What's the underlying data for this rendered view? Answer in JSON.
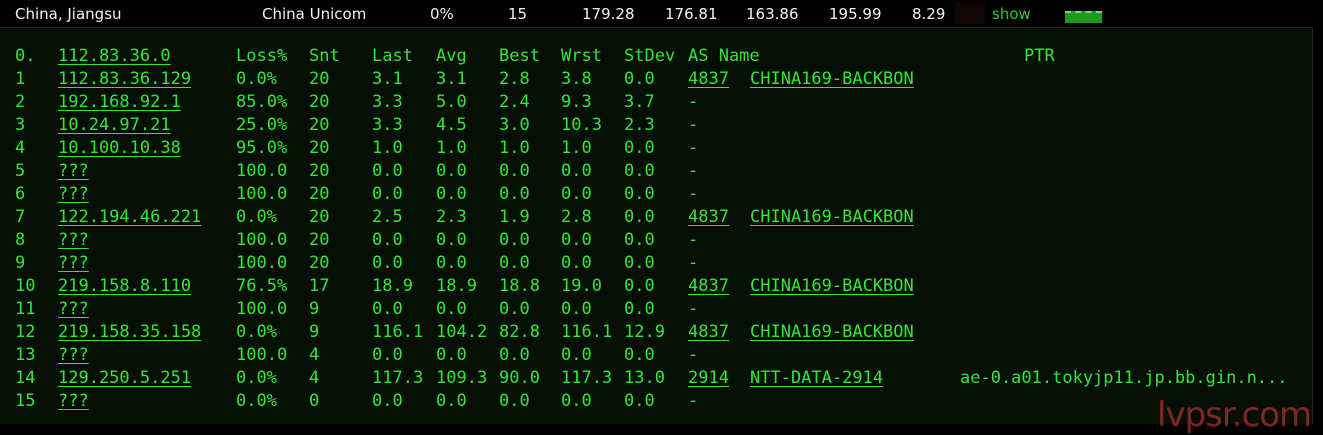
{
  "summary": {
    "location": "China, Jiangsu",
    "isp": "China Unicom",
    "loss": "0%",
    "sent": "15",
    "last": "179.28",
    "avg": "176.81",
    "best": "163.86",
    "worst": "195.99",
    "stdev": "8.29",
    "show_label": "show"
  },
  "headers": {
    "index": "0.",
    "host": "112.83.36.0",
    "loss": "Loss%",
    "snt": "Snt",
    "last": "Last",
    "avg": "Avg",
    "best": "Best",
    "wrst": "Wrst",
    "stdev": "StDev",
    "as_name": "AS Name",
    "ptr": "PTR"
  },
  "hops": [
    {
      "n": "1",
      "host": "112.83.36.129",
      "loss": "0.0%",
      "snt": "20",
      "last": "3.1",
      "avg": "3.1",
      "best": "2.8",
      "wrst": "3.8",
      "stdev": "0.0",
      "asn": "4837",
      "as_name": "CHINA169-BACKBON",
      "ptr": ""
    },
    {
      "n": "2",
      "host": "192.168.92.1",
      "loss": "85.0%",
      "snt": "20",
      "last": "3.3",
      "avg": "5.0",
      "best": "2.4",
      "wrst": "9.3",
      "stdev": "3.7",
      "asn": "-",
      "as_name": "",
      "ptr": ""
    },
    {
      "n": "3",
      "host": "10.24.97.21",
      "loss": "25.0%",
      "snt": "20",
      "last": "3.3",
      "avg": "4.5",
      "best": "3.0",
      "wrst": "10.3",
      "stdev": "2.3",
      "asn": "-",
      "as_name": "",
      "ptr": ""
    },
    {
      "n": "4",
      "host": "10.100.10.38",
      "loss": "95.0%",
      "snt": "20",
      "last": "1.0",
      "avg": "1.0",
      "best": "1.0",
      "wrst": "1.0",
      "stdev": "0.0",
      "asn": "-",
      "as_name": "",
      "ptr": ""
    },
    {
      "n": "5",
      "host": "???",
      "loss": "100.0",
      "snt": "20",
      "last": "0.0",
      "avg": "0.0",
      "best": "0.0",
      "wrst": "0.0",
      "stdev": "0.0",
      "asn": "-",
      "as_name": "",
      "ptr": ""
    },
    {
      "n": "6",
      "host": "???",
      "loss": "100.0",
      "snt": "20",
      "last": "0.0",
      "avg": "0.0",
      "best": "0.0",
      "wrst": "0.0",
      "stdev": "0.0",
      "asn": "-",
      "as_name": "",
      "ptr": ""
    },
    {
      "n": "7",
      "host": "122.194.46.221",
      "loss": "0.0%",
      "snt": "20",
      "last": "2.5",
      "avg": "2.3",
      "best": "1.9",
      "wrst": "2.8",
      "stdev": "0.0",
      "asn": "4837",
      "as_name": "CHINA169-BACKBON",
      "ptr": ""
    },
    {
      "n": "8",
      "host": "???",
      "loss": "100.0",
      "snt": "20",
      "last": "0.0",
      "avg": "0.0",
      "best": "0.0",
      "wrst": "0.0",
      "stdev": "0.0",
      "asn": "-",
      "as_name": "",
      "ptr": ""
    },
    {
      "n": "9",
      "host": "???",
      "loss": "100.0",
      "snt": "20",
      "last": "0.0",
      "avg": "0.0",
      "best": "0.0",
      "wrst": "0.0",
      "stdev": "0.0",
      "asn": "-",
      "as_name": "",
      "ptr": ""
    },
    {
      "n": "10",
      "host": "219.158.8.110",
      "loss": "76.5%",
      "snt": "17",
      "last": "18.9",
      "avg": "18.9",
      "best": "18.8",
      "wrst": "19.0",
      "stdev": "0.0",
      "asn": "4837",
      "as_name": "CHINA169-BACKBON",
      "ptr": ""
    },
    {
      "n": "11",
      "host": "???",
      "loss": "100.0",
      "snt": "9",
      "last": "0.0",
      "avg": "0.0",
      "best": "0.0",
      "wrst": "0.0",
      "stdev": "0.0",
      "asn": "-",
      "as_name": "",
      "ptr": ""
    },
    {
      "n": "12",
      "host": "219.158.35.158",
      "loss": "0.0%",
      "snt": "9",
      "last": "116.1",
      "avg": "104.2",
      "best": "82.8",
      "wrst": "116.1",
      "stdev": "12.9",
      "asn": "4837",
      "as_name": "CHINA169-BACKBON",
      "ptr": ""
    },
    {
      "n": "13",
      "host": "???",
      "loss": "100.0",
      "snt": "4",
      "last": "0.0",
      "avg": "0.0",
      "best": "0.0",
      "wrst": "0.0",
      "stdev": "0.0",
      "asn": "-",
      "as_name": "",
      "ptr": ""
    },
    {
      "n": "14",
      "host": "129.250.5.251",
      "loss": "0.0%",
      "snt": "4",
      "last": "117.3",
      "avg": "109.3",
      "best": "90.0",
      "wrst": "117.3",
      "stdev": "13.0",
      "asn": "2914",
      "as_name": "NTT-DATA-2914",
      "ptr": "ae-0.a01.tokyjp11.jp.bb.gin.n..."
    },
    {
      "n": "15",
      "host": "???",
      "loss": "0.0%",
      "snt": "0",
      "last": "0.0",
      "avg": "0.0",
      "best": "0.0",
      "wrst": "0.0",
      "stdev": "0.0",
      "asn": "-",
      "as_name": "",
      "ptr": ""
    }
  ],
  "watermark": "lvpsr.com",
  "colors": {
    "text": "#33e633",
    "background": "#050f05",
    "summary_text": "#f2f2f2",
    "watermark": "#e63c3c"
  }
}
